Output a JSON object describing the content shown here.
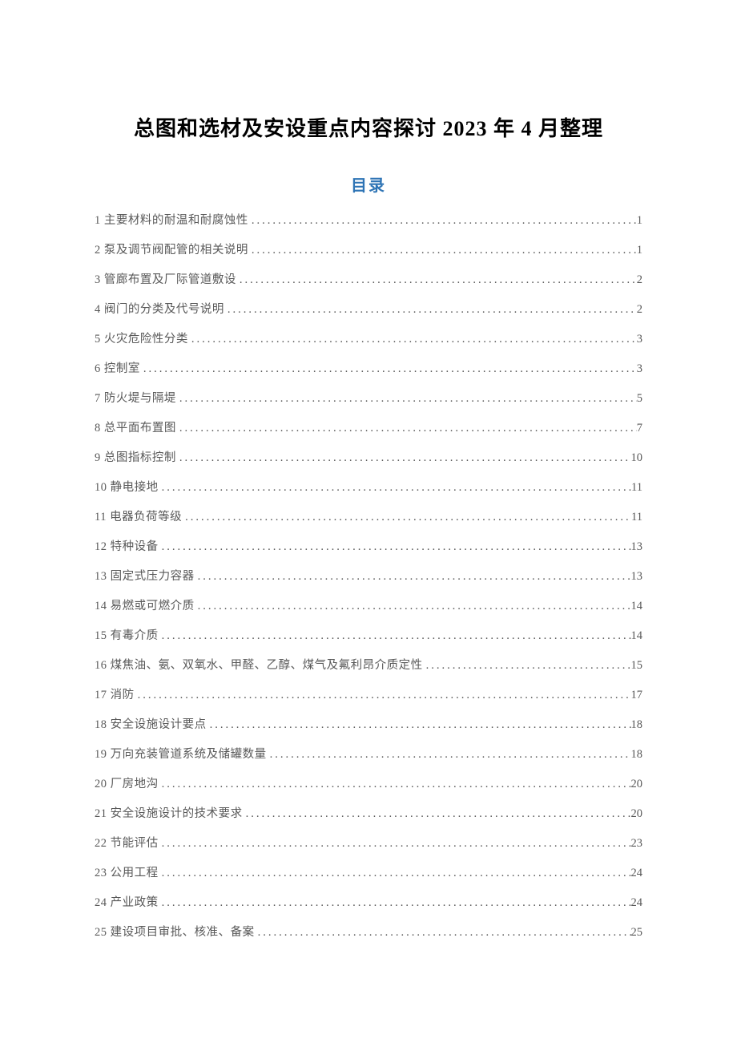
{
  "title": "总图和选材及安设重点内容探讨 2023 年 4 月整理",
  "toc_label": "目录",
  "toc": [
    {
      "label": "1 主要材料的耐温和耐腐蚀性",
      "page": "1"
    },
    {
      "label": "2 泵及调节阀配管的相关说明",
      "page": "1"
    },
    {
      "label": "3 管廊布置及厂际管道敷设",
      "page": "2"
    },
    {
      "label": "4 阀门的分类及代号说明",
      "page": "2"
    },
    {
      "label": "5 火灾危险性分类",
      "page": "3"
    },
    {
      "label": "6 控制室",
      "page": "3"
    },
    {
      "label": "7 防火堤与隔堤",
      "page": "5"
    },
    {
      "label": "8 总平面布置图",
      "page": "7"
    },
    {
      "label": "9 总图指标控制",
      "page": "10"
    },
    {
      "label": "10 静电接地",
      "page": "11"
    },
    {
      "label": "11 电器负荷等级",
      "page": "11"
    },
    {
      "label": "12 特种设备",
      "page": "13"
    },
    {
      "label": "13 固定式压力容器",
      "page": "13"
    },
    {
      "label": "14 易燃或可燃介质",
      "page": "14"
    },
    {
      "label": "15 有毒介质",
      "page": "14"
    },
    {
      "label": "16 煤焦油、氨、双氧水、甲醛、乙醇、煤气及氟利昂介质定性",
      "page": "15"
    },
    {
      "label": "17 消防",
      "page": "17"
    },
    {
      "label": "18 安全设施设计要点",
      "page": "18"
    },
    {
      "label": "19 万向充装管道系统及储罐数量",
      "page": "18"
    },
    {
      "label": "20 厂房地沟",
      "page": "20"
    },
    {
      "label": "21 安全设施设计的技术要求",
      "page": "20"
    },
    {
      "label": "22 节能评估",
      "page": "23"
    },
    {
      "label": "23 公用工程",
      "page": "24"
    },
    {
      "label": "24 产业政策",
      "page": "24"
    },
    {
      "label": "25 建设项目审批、核准、备案",
      "page": "25"
    }
  ]
}
